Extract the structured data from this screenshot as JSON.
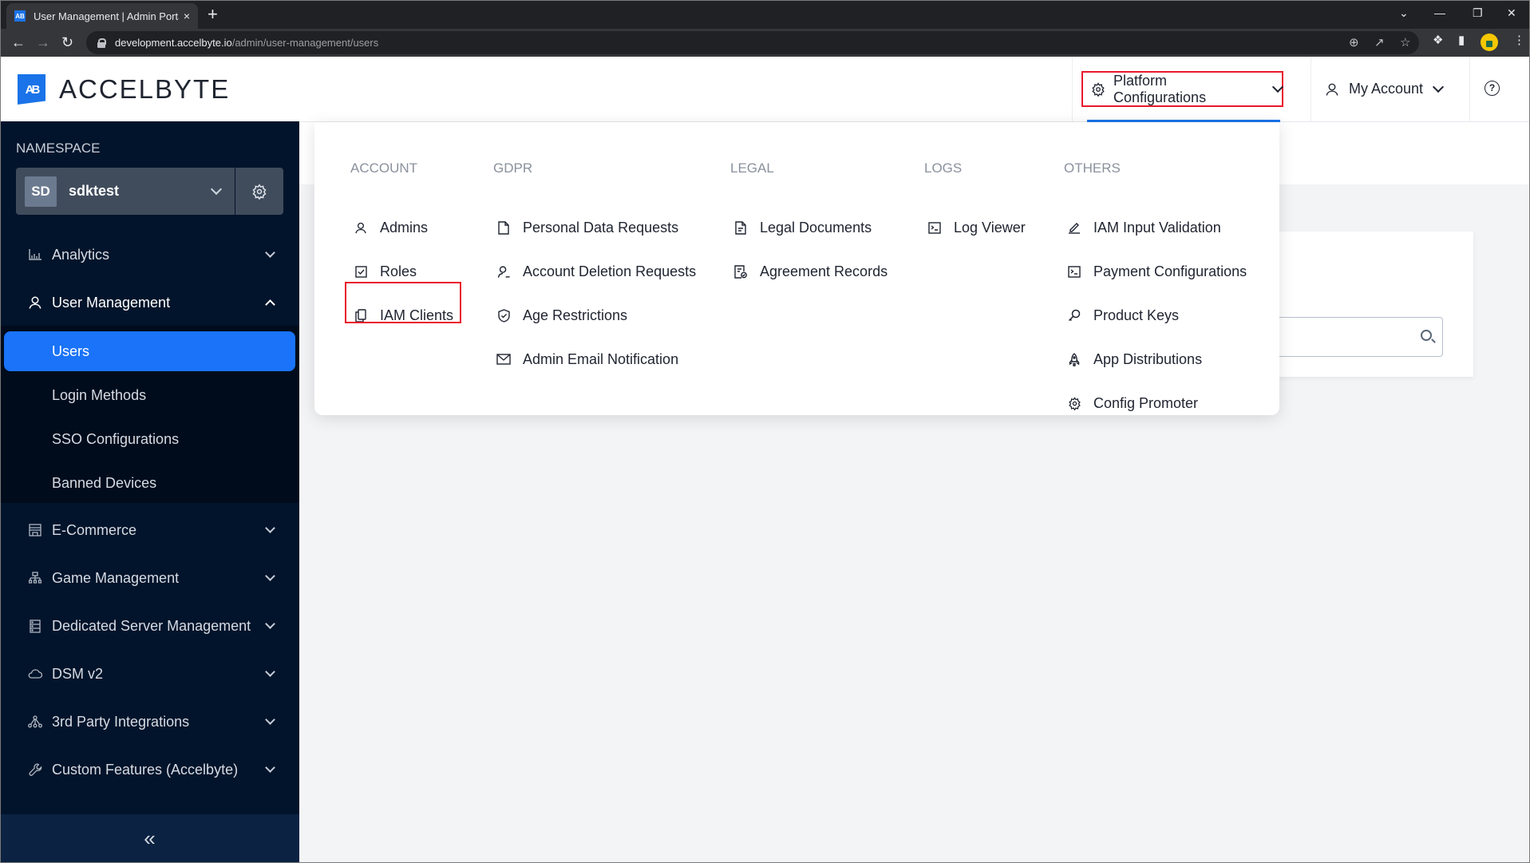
{
  "browser": {
    "tab_title": "User Management | Admin Portal",
    "tab_close": "×",
    "new_tab": "+",
    "url_host": "development.accelbyte.io",
    "url_path": "/admin/user-management/users"
  },
  "header": {
    "logo_mark": "AB",
    "logo_text": "ACCELBYTE",
    "platform_config_label": "Platform Configurations",
    "my_account_label": "My Account",
    "help_label": "?"
  },
  "sidebar": {
    "namespace_label": "NAMESPACE",
    "namespace_avatar": "SD",
    "namespace_name": "sdktest",
    "items": [
      {
        "label": "Analytics",
        "icon": "bar-chart-icon"
      },
      {
        "label": "User Management",
        "icon": "user-icon",
        "expanded": true
      },
      {
        "label": "E-Commerce",
        "icon": "store-icon"
      },
      {
        "label": "Game Management",
        "icon": "hierarchy-icon"
      },
      {
        "label": "Dedicated Server Management",
        "icon": "server-icon"
      },
      {
        "label": "DSM v2",
        "icon": "cloud-icon"
      },
      {
        "label": "3rd Party Integrations",
        "icon": "network-icon"
      },
      {
        "label": "Custom Features (Accelbyte)",
        "icon": "wrench-icon"
      }
    ],
    "user_management_sub": [
      {
        "label": "Users",
        "active": true
      },
      {
        "label": "Login Methods"
      },
      {
        "label": "SSO Configurations"
      },
      {
        "label": "Banned Devices"
      }
    ],
    "collapse_label": "«"
  },
  "dropdown": {
    "columns": [
      {
        "title": "ACCOUNT",
        "items": [
          {
            "label": "Admins",
            "icon": "user-icon"
          },
          {
            "label": "Roles",
            "icon": "checkbox-icon"
          },
          {
            "label": "IAM Clients",
            "icon": "copy-icon",
            "highlighted": true
          }
        ]
      },
      {
        "title": "GDPR",
        "items": [
          {
            "label": "Personal Data Requests",
            "icon": "file-icon"
          },
          {
            "label": "Account Deletion Requests",
            "icon": "user-remove-icon"
          },
          {
            "label": "Age Restrictions",
            "icon": "shield-check-icon"
          },
          {
            "label": "Admin Email Notification",
            "icon": "mail-icon"
          }
        ]
      },
      {
        "title": "LEGAL",
        "items": [
          {
            "label": "Legal Documents",
            "icon": "document-icon"
          },
          {
            "label": "Agreement Records",
            "icon": "document-check-icon"
          }
        ]
      },
      {
        "title": "LOGS",
        "items": [
          {
            "label": "Log Viewer",
            "icon": "terminal-icon"
          }
        ]
      },
      {
        "title": "OTHERS",
        "items": [
          {
            "label": "IAM Input Validation",
            "icon": "pencil-icon"
          },
          {
            "label": "Payment Configurations",
            "icon": "terminal-icon"
          },
          {
            "label": "Product Keys",
            "icon": "key-icon"
          },
          {
            "label": "App Distributions",
            "icon": "rocket-icon"
          },
          {
            "label": "Config Promoter",
            "icon": "gear-icon"
          }
        ]
      }
    ]
  },
  "colors": {
    "accent": "#1a73f8",
    "sidebar_bg": "#02142b",
    "highlight_box": "#e8192c"
  }
}
